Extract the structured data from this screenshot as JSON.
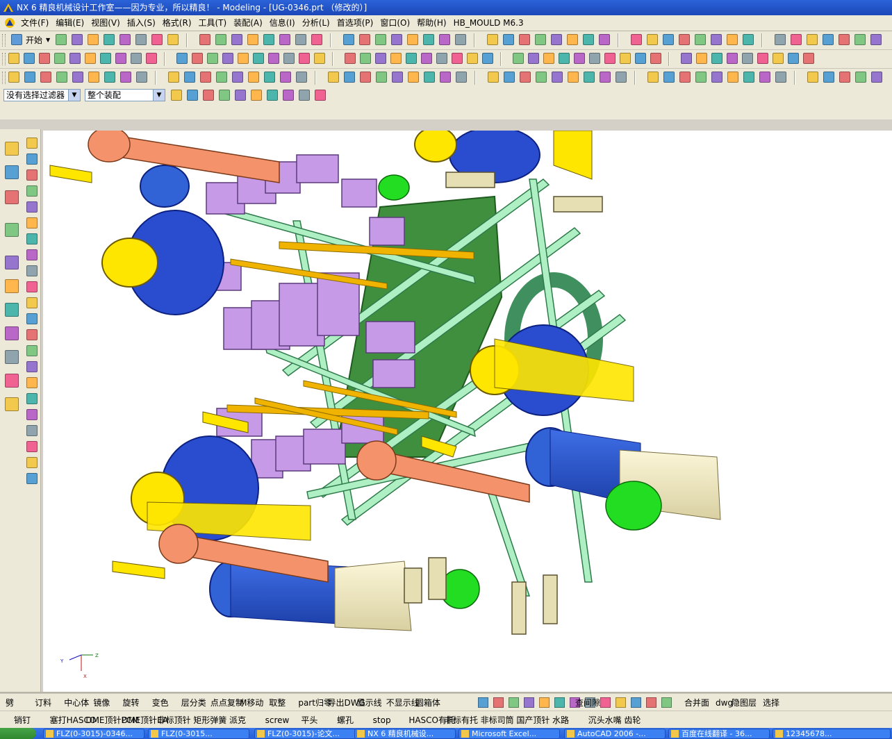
{
  "window": {
    "title": "NX 6 精良机械设计工作室——因为专业，所以精良！ - Modeling - [UG-0346.prt （修改的）]"
  },
  "menubar": {
    "items": [
      "文件(F)",
      "编辑(E)",
      "视图(V)",
      "插入(S)",
      "格式(R)",
      "工具(T)",
      "装配(A)",
      "信息(I)",
      "分析(L)",
      "首选项(P)",
      "窗口(O)",
      "帮助(H)",
      "HB_MOULD M6.3"
    ]
  },
  "toolbar": {
    "start_label": "开始"
  },
  "selection": {
    "filter_value": "没有选择过滤器",
    "scope_value": "整个装配"
  },
  "viewport": {
    "background": "#ffffff",
    "triad": {
      "x": "X",
      "y": "Y",
      "z": "Z"
    }
  },
  "bottom1": {
    "items": [
      "劈",
      "订料",
      "中心体",
      "镜像",
      "旋转",
      "变色",
      "层分类",
      "点点复制",
      "M移动",
      "取整",
      "part归零",
      "导出DWG",
      "显示线",
      "不显示线",
      "圆箱体"
    ],
    "items2": [
      "查间隙",
      "合并面",
      "dwg",
      "隐图层",
      "选择"
    ]
  },
  "bottom2": {
    "items": [
      "销钉",
      "塞打HASCO",
      "DME顶针PCM",
      "DME顶针EA",
      "非标顶针",
      "矩形弹簧",
      "派克",
      "screw",
      "平头",
      "螺孔",
      "stop",
      "HASCO有托",
      "非标有托",
      "非标司筒",
      "国产顶针",
      "水路",
      "沉头水嘴",
      "齿轮"
    ]
  },
  "taskbar": {
    "items": [
      "FLZ(0-3015)-0346...",
      "FLZ(0-3015...",
      "FLZ(0-3015)-论文...",
      "NX 6 精良机械设...",
      "Microsoft Excel...",
      "AutoCAD 2006 -...",
      "百度在线翻译 - 36...",
      "12345678..."
    ]
  },
  "colors": {
    "accent": "#245edb",
    "chrome": "#ece9d8",
    "blue_part": "#2457d6",
    "yellow_part": "#ffe600",
    "violet_part": "#c79ae8",
    "green_part": "#b7f0c9",
    "orange_part": "#f4936b"
  }
}
